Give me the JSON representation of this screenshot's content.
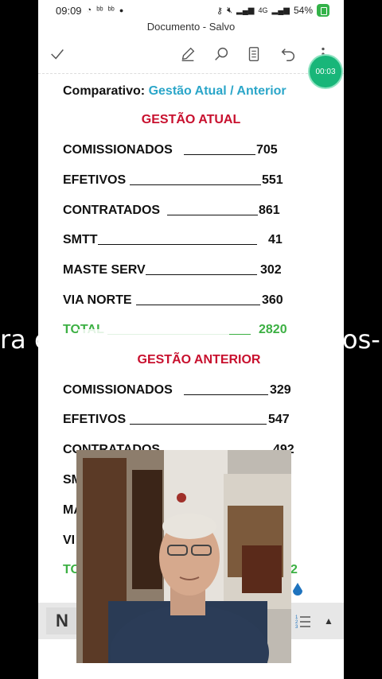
{
  "status_bar": {
    "time": "09:09",
    "left_icons": [
      "whatsapp-icon",
      "app-icon",
      "app-icon",
      "dot-icon"
    ],
    "right_icons": [
      "key-icon",
      "mute-icon",
      "signal-icon",
      "volte-icon",
      "network-4g-icon"
    ],
    "battery": "54%",
    "colors": {
      "battery_icon": "#33b249"
    }
  },
  "app": {
    "title": "Documento - Salvo"
  },
  "toolbar": {
    "icons": [
      "check-icon",
      "pen-icon",
      "search-icon",
      "reading-mode-icon",
      "undo-icon",
      "more-icon"
    ]
  },
  "timer": {
    "label": "00:03",
    "color": "#18b679"
  },
  "document": {
    "heading_prefix": "Comparativo:",
    "heading_accent": "Gestão Atual / Anterior",
    "accent_color": "#2ba6c9",
    "sections": [
      {
        "title": "GESTÃO ATUAL",
        "title_color": "#c8102e",
        "rows": [
          {
            "label": "COMISSIONADOS",
            "value": "705"
          },
          {
            "label": "EFETIVOS",
            "value": "551"
          },
          {
            "label": "CONTRATADOS",
            "value": "861"
          },
          {
            "label": "SMTT",
            "value": "41"
          },
          {
            "label": "MASTE SERV",
            "value": "302"
          },
          {
            "label": "VIA NORTE",
            "value": "360"
          }
        ],
        "total": {
          "label": "TOTAL",
          "value": "2820",
          "color": "#3cb043"
        }
      },
      {
        "title": "GESTÃO ANTERIOR",
        "title_color": "#c8102e",
        "rows": [
          {
            "label": "COMISSIONADOS",
            "value": "329"
          },
          {
            "label": "EFETIVOS",
            "value": "547"
          },
          {
            "label": "CONTRATADOS",
            "value": "492"
          },
          {
            "label": "SM",
            "value": ""
          },
          {
            "label": "MA",
            "value": ""
          },
          {
            "label": "VI",
            "value": ""
          }
        ],
        "total": {
          "label": "TO",
          "value": "2",
          "color": "#3cb043"
        }
      }
    ]
  },
  "caption": {
    "left": "ra c",
    "right": "os-"
  },
  "format_bar": {
    "style_label": "N",
    "icons": [
      "numbered-list-icon",
      "expand-up-icon"
    ]
  },
  "webcam": {
    "description_icon": "webcam-overlay"
  }
}
